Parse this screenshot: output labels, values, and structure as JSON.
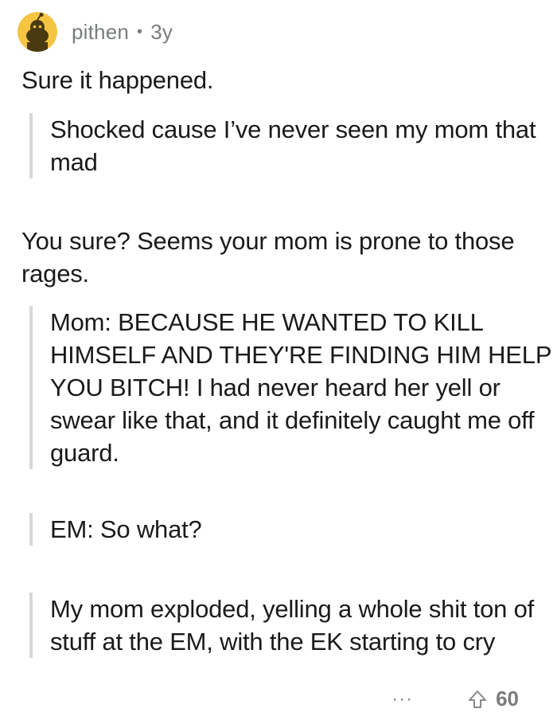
{
  "comment": {
    "author": "pithen",
    "separator": "•",
    "age": "3y",
    "paragraphs": [
      "Sure it happened.",
      "You sure? Seems your mom is prone to those rages."
    ],
    "quotes": [
      "Shocked cause I’ve never seen my mom that mad",
      "Mom: BECAUSE HE WANTED TO KILL HIMSELF AND THEY'RE FINDING HIM HELP YOU BITCH! I had never heard her yell or swear like that, and it definitely caught me off guard.",
      "EM: So what?",
      "My mom exploded, yelling a whole shit ton of stuff at the EM, with the EK starting to cry"
    ],
    "more_label": "···",
    "score": "60"
  },
  "icons": {
    "avatar": "snoo-avatar-icon",
    "more": "more-options-icon",
    "upvote": "upvote-arrow-icon"
  },
  "colors": {
    "avatar_bg": "#f5c542",
    "avatar_dark": "#4a3a12",
    "meta_text": "#7c7c7c",
    "quote_bar": "#d7d7d7"
  }
}
